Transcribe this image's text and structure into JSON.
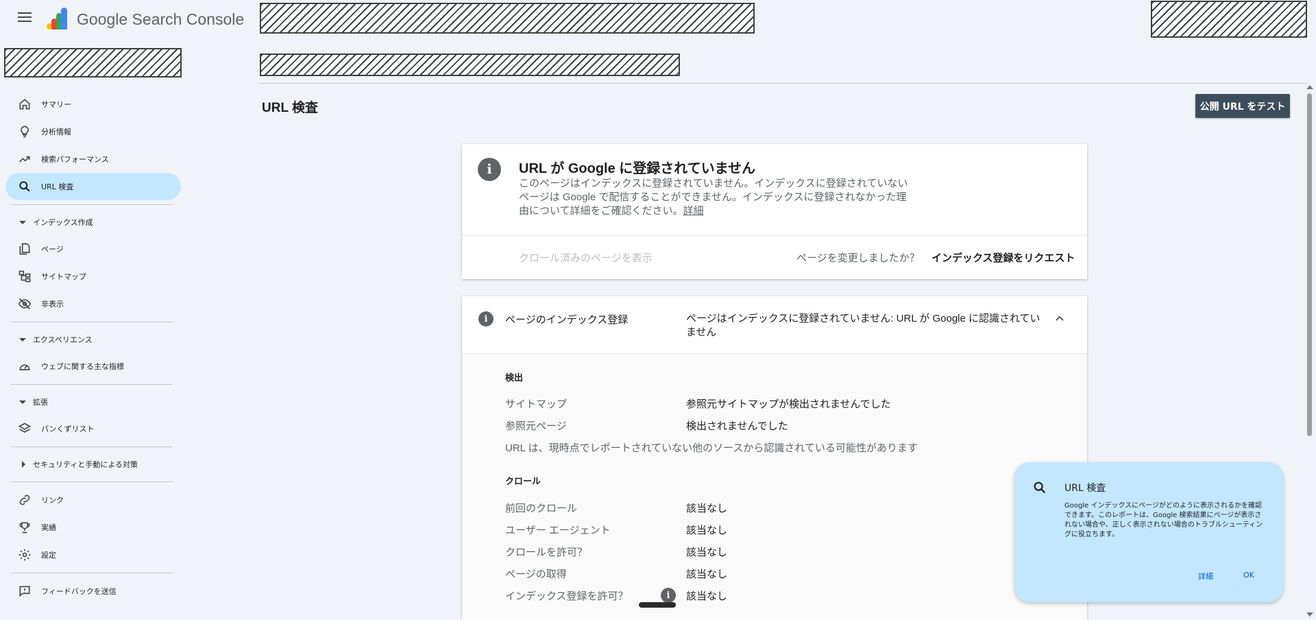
{
  "header": {
    "app_title": "Google Search Console",
    "menu_icon": "hamburger-menu-icon",
    "logo_colors": [
      "#fbbc04",
      "#ea4335",
      "#34a853",
      "#4285f4"
    ]
  },
  "sidebar": {
    "items": [
      {
        "label": "サマリー",
        "icon": "home-icon"
      },
      {
        "label": "分析情報",
        "icon": "lightbulb-icon"
      },
      {
        "label": "検索パフォーマンス",
        "icon": "trending-up-icon"
      },
      {
        "label": "URL 検査",
        "icon": "search-icon",
        "active": true
      }
    ],
    "sections": [
      {
        "label": "インデックス作成",
        "expanded": true,
        "items": [
          {
            "label": "ページ",
            "icon": "pages-icon"
          },
          {
            "label": "サイトマップ",
            "icon": "sitemap-icon"
          },
          {
            "label": "非表示",
            "icon": "visibility-off-icon"
          }
        ]
      },
      {
        "label": "エクスペリエンス",
        "expanded": true,
        "items": [
          {
            "label": "ウェブに関する主な指標",
            "icon": "speed-icon"
          }
        ]
      },
      {
        "label": "拡張",
        "expanded": true,
        "items": [
          {
            "label": "パンくずリスト",
            "icon": "layers-icon"
          }
        ]
      },
      {
        "label": "セキュリティと手動による対策",
        "expanded": false,
        "items": []
      }
    ],
    "bottom_items": [
      {
        "label": "リンク",
        "icon": "link-icon"
      },
      {
        "label": "実績",
        "icon": "trophy-icon"
      },
      {
        "label": "設定",
        "icon": "gear-icon"
      }
    ],
    "feedback": {
      "label": "フィードバックを送信",
      "icon": "feedback-icon"
    },
    "active_color": "#c2e7ff"
  },
  "main": {
    "page_title": "URL 検査",
    "test_button": "公開 URL をテスト",
    "status_card": {
      "title": "URL が Google に登録されていません",
      "desc_lines": [
        "このページはインデックスに登録されていません。インデックスに登録されていない",
        "ページは Google で配信することができません。インデックスに登録されなかった理",
        "由について詳細をご確認ください。"
      ],
      "detail_link": "詳細",
      "crawled_link": "クロール済みのページを表示",
      "changed_question": "ページを変更しましたか？",
      "request_button": "インデックス登録をリクエスト"
    },
    "indexing_card": {
      "name": "ページのインデックス登録",
      "status_lines": [
        "ページはインデックスに登録されていません: URL が Google に認識されてい",
        "ません"
      ],
      "detection": {
        "heading": "検出",
        "rows": [
          {
            "key": "サイトマップ",
            "value": "参照元サイトマップが検出されませんでした"
          },
          {
            "key": "参照元ページ",
            "value": "検出されませんでした"
          }
        ],
        "note": "URL は、現時点でレポートされていない他のソースから認識されている可能性があります"
      },
      "crawl": {
        "heading": "クロール",
        "rows": [
          {
            "key": "前回のクロール",
            "value": "該当なし"
          },
          {
            "key": "ユーザー エージェント",
            "value": "該当なし"
          },
          {
            "key": "クロールを許可？",
            "value": "該当なし"
          },
          {
            "key": "ページの取得",
            "value": "該当なし"
          },
          {
            "key": "インデックス登録を許可？",
            "value": "該当なし"
          }
        ]
      }
    }
  },
  "popup": {
    "title": "URL 検査",
    "body": "Google インデックスにページがどのように表示されるかを確認できます。このレポートは、Google 検索結果にページが表示されない場合や、正しく表示されない場合のトラブルシューティングに役立ちます。",
    "detail": "詳細",
    "ok": "OK",
    "color": "#c2e7ff"
  }
}
